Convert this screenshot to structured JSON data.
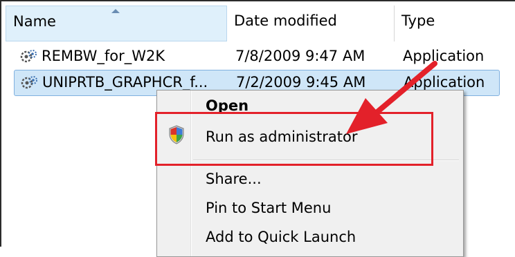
{
  "columns": {
    "name": "Name",
    "date": "Date modified",
    "type": "Type"
  },
  "files": [
    {
      "name": "REMBW_for_W2K",
      "date": "7/8/2009 9:47 AM",
      "type": "Application",
      "icon": "application-icon"
    },
    {
      "name": "UNIPRTB_GRAPHCR_f...",
      "date": "7/2/2009 9:45 AM",
      "type": "Application",
      "icon": "application-icon",
      "selected": true
    }
  ],
  "context_menu": {
    "open": "Open",
    "run_as_admin": "Run as administrator",
    "share": "Share...",
    "pin_start": "Pin to Start Menu",
    "quick_launch": "Add to Quick Launch"
  },
  "colors": {
    "highlight_box": "#e3212a",
    "arrow": "#e3212a",
    "selection": "#cfe6f8"
  }
}
